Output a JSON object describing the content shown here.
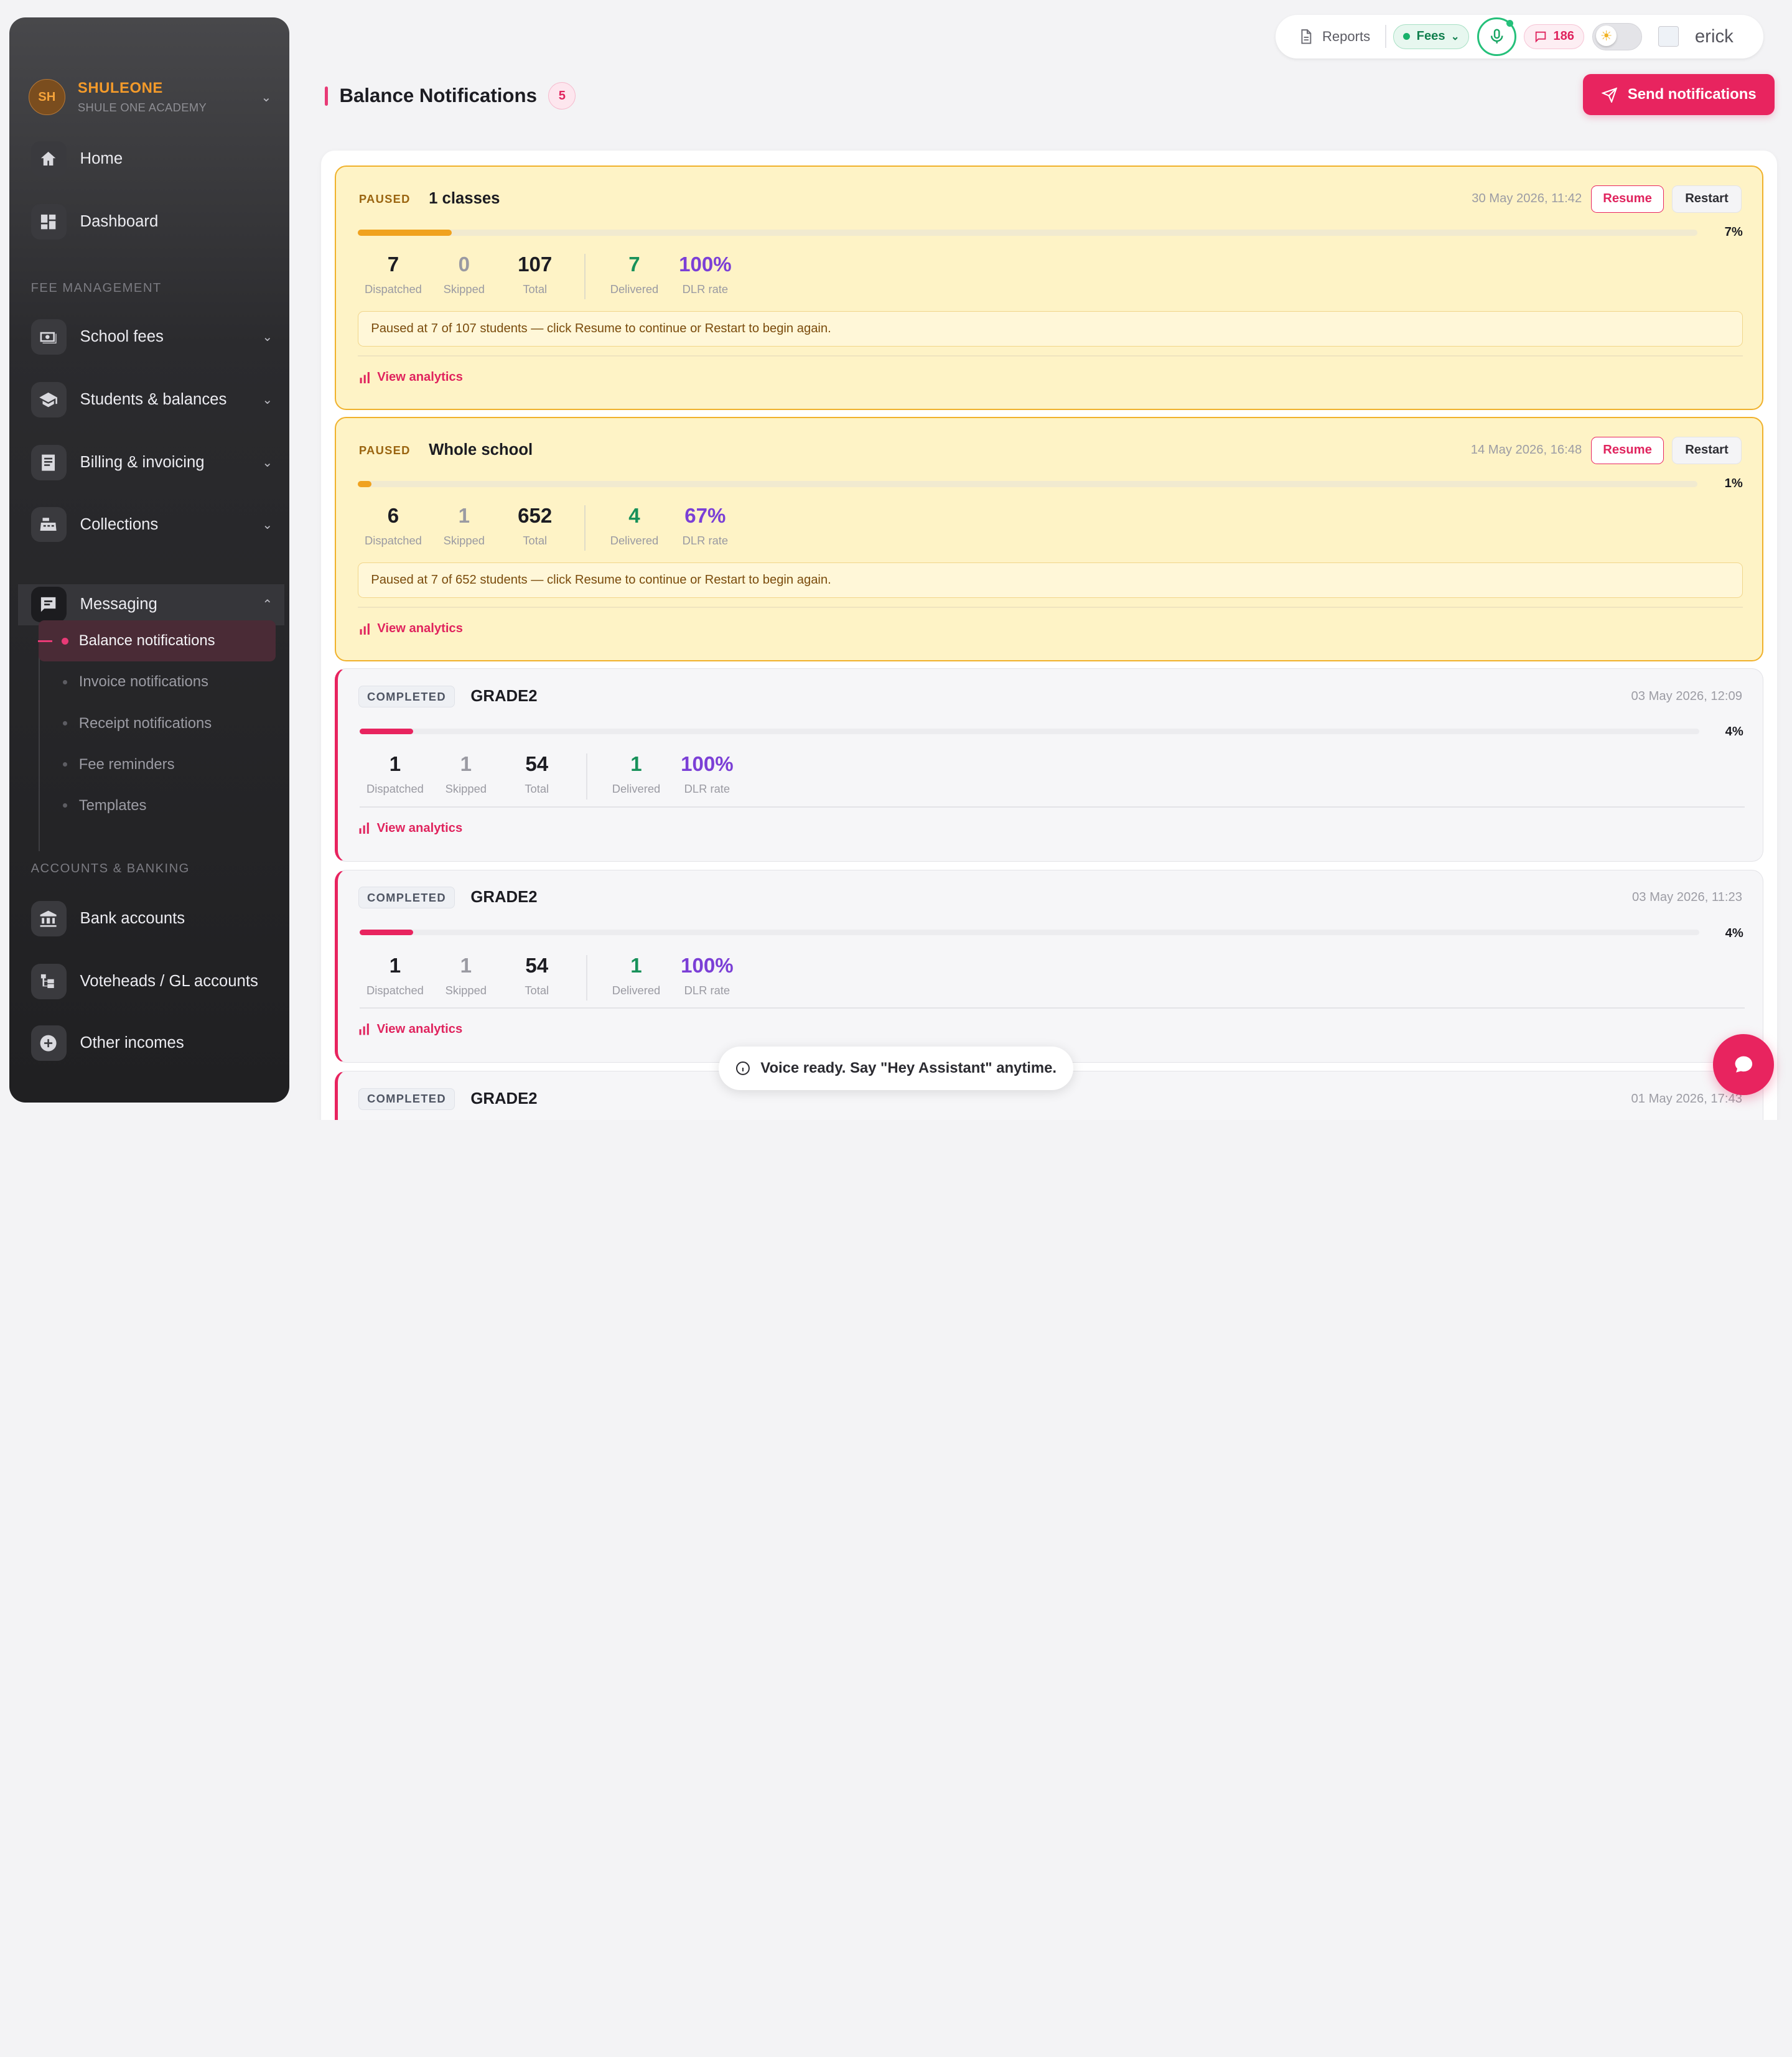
{
  "sidebar": {
    "avatar_initials": "SH",
    "brand_name": "SHULEONE",
    "brand_sub": "SHULE ONE ACADEMY",
    "items": [
      {
        "label": "Home",
        "icon": "home-icon"
      },
      {
        "label": "Dashboard",
        "icon": "dashboard-icon"
      }
    ],
    "section_fee": "FEE MANAGEMENT",
    "fee_items": [
      {
        "label": "School fees",
        "icon": "money-icon"
      },
      {
        "label": "Students & balances",
        "icon": "graduation-cap-icon"
      },
      {
        "label": "Billing & invoicing",
        "icon": "invoice-icon"
      },
      {
        "label": "Collections",
        "icon": "cash-register-icon"
      },
      {
        "label": "Messaging",
        "icon": "message-icon"
      }
    ],
    "messaging_sub": [
      {
        "label": "Balance notifications",
        "active": true
      },
      {
        "label": "Invoice notifications"
      },
      {
        "label": "Receipt notifications"
      },
      {
        "label": "Fee reminders"
      },
      {
        "label": "Templates"
      }
    ],
    "section_accounts": "ACCOUNTS & BANKING",
    "account_items": [
      {
        "label": "Bank accounts",
        "icon": "bank-icon"
      },
      {
        "label": "Voteheads / GL accounts",
        "icon": "tree-icon"
      },
      {
        "label": "Other incomes",
        "icon": "plus-circle-icon"
      }
    ]
  },
  "topbar": {
    "reports_label": "Reports",
    "fees_label": "Fees",
    "messages_count": "186",
    "user_name": "erick"
  },
  "header": {
    "title": "Balance Notifications",
    "count": "5",
    "send_label": "Send notifications"
  },
  "stat_labels": {
    "dispatched": "Dispatched",
    "skipped": "Skipped",
    "total": "Total",
    "delivered": "Delivered",
    "rate": "DLR rate"
  },
  "actions": {
    "resume": "Resume",
    "restart": "Restart",
    "view_analytics": "View analytics"
  },
  "cards": [
    {
      "status": "PAUSED",
      "title": "1 classes",
      "date": "30 May 2026, 11:42",
      "progress": 7,
      "progress_label": "7%",
      "dispatched": "7",
      "skipped": "0",
      "total": "107",
      "delivered": "7",
      "rate": "100%",
      "note": "Paused at 7 of 107 students — click Resume to continue or Restart to begin again."
    },
    {
      "status": "PAUSED",
      "title": "Whole school",
      "date": "14 May 2026, 16:48",
      "progress": 1,
      "progress_label": "1%",
      "dispatched": "6",
      "skipped": "1",
      "total": "652",
      "delivered": "4",
      "rate": "67%",
      "note": "Paused at 7 of 652 students — click Resume to continue or Restart to begin again."
    },
    {
      "status": "COMPLETED",
      "title": "GRADE2",
      "date": "03 May 2026, 12:09",
      "progress": 4,
      "progress_label": "4%",
      "dispatched": "1",
      "skipped": "1",
      "total": "54",
      "delivered": "1",
      "rate": "100%"
    },
    {
      "status": "COMPLETED",
      "title": "GRADE2",
      "date": "03 May 2026, 11:23",
      "progress": 4,
      "progress_label": "4%",
      "dispatched": "1",
      "skipped": "1",
      "total": "54",
      "delivered": "1",
      "rate": "100%"
    },
    {
      "status": "COMPLETED",
      "title": "GRADE2",
      "date": "01 May 2026, 17:43"
    }
  ],
  "toast": {
    "text": "Voice ready. Say \"Hey Assistant\" anytime."
  },
  "colors": {
    "accent": "#e8245f",
    "paused_bg": "#fef3c6",
    "paused_border": "#f0b12b",
    "delivered": "#18915a",
    "rate": "#7b3fd6"
  }
}
